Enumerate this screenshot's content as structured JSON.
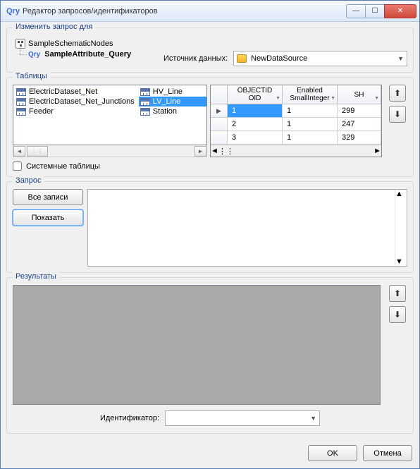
{
  "window": {
    "prefix": "Qry",
    "title": "Редактор запросов/идентификаторов"
  },
  "change_group": {
    "legend": "Изменить запрос для",
    "tree": {
      "root": "SampleSchematicNodes",
      "child_prefix": "Qry",
      "child": "SampleAttribute_Query"
    },
    "source_label": "Источник данных:",
    "source_value": "NewDataSource"
  },
  "tables_group": {
    "legend": "Таблицы",
    "col1": [
      "ElectricDataset_Net",
      "ElectricDataset_Net_Junctions",
      "Feeder"
    ],
    "col2": [
      "HV_Line",
      "LV_Line",
      "Station"
    ],
    "selected": "LV_Line",
    "system_tables": "Системные таблицы",
    "grid": {
      "headers": [
        {
          "line1": "OBJECTID",
          "line2": "OID"
        },
        {
          "line1": "Enabled",
          "line2": "SmallInteger"
        },
        {
          "line1": "SH",
          "line2": ""
        }
      ],
      "rows": [
        {
          "c1": "1",
          "c2": "1",
          "c3": "299"
        },
        {
          "c1": "2",
          "c2": "1",
          "c3": "247"
        },
        {
          "c1": "3",
          "c2": "1",
          "c3": "329"
        }
      ]
    }
  },
  "query_group": {
    "legend": "Запрос",
    "all_records": "Все записи",
    "show": "Показать"
  },
  "results_group": {
    "legend": "Результаты",
    "identifier_label": "Идентификатор:",
    "identifier_value": ""
  },
  "footer": {
    "ok": "OK",
    "cancel": "Отмена"
  }
}
